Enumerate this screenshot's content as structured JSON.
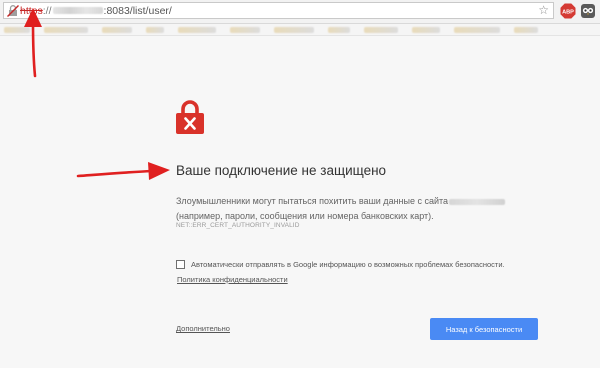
{
  "browser": {
    "url": {
      "scheme": "https",
      "separator": "://",
      "path": ":8083/list/user/"
    },
    "star_icon": "star-icon",
    "extensions": {
      "abp_label": "ABP",
      "abp_color": "#d43a33",
      "owl_icon": "owl-icon"
    }
  },
  "interstitial": {
    "error_icon": "padlock-x-icon",
    "error_color": "#d9322a",
    "heading": "Ваше подключение не защищено",
    "description_line1": "Злоумышленники могут пытаться похитить ваши данные с сайта",
    "description_line2": "(например, пароли, сообщения или номера банковских карт).",
    "error_code": "NET::ERR_CERT_AUTHORITY_INVALID",
    "checkbox_label": "Автоматически отправлять в Google информацию о возможных проблемах безопасности.",
    "privacy_link": "Политика конфиденциальности",
    "details_link": "Дополнительно",
    "back_button": "Назад к безопасности",
    "button_color": "#4a8af4"
  },
  "annotations": {
    "arrow_color": "#e02020"
  }
}
